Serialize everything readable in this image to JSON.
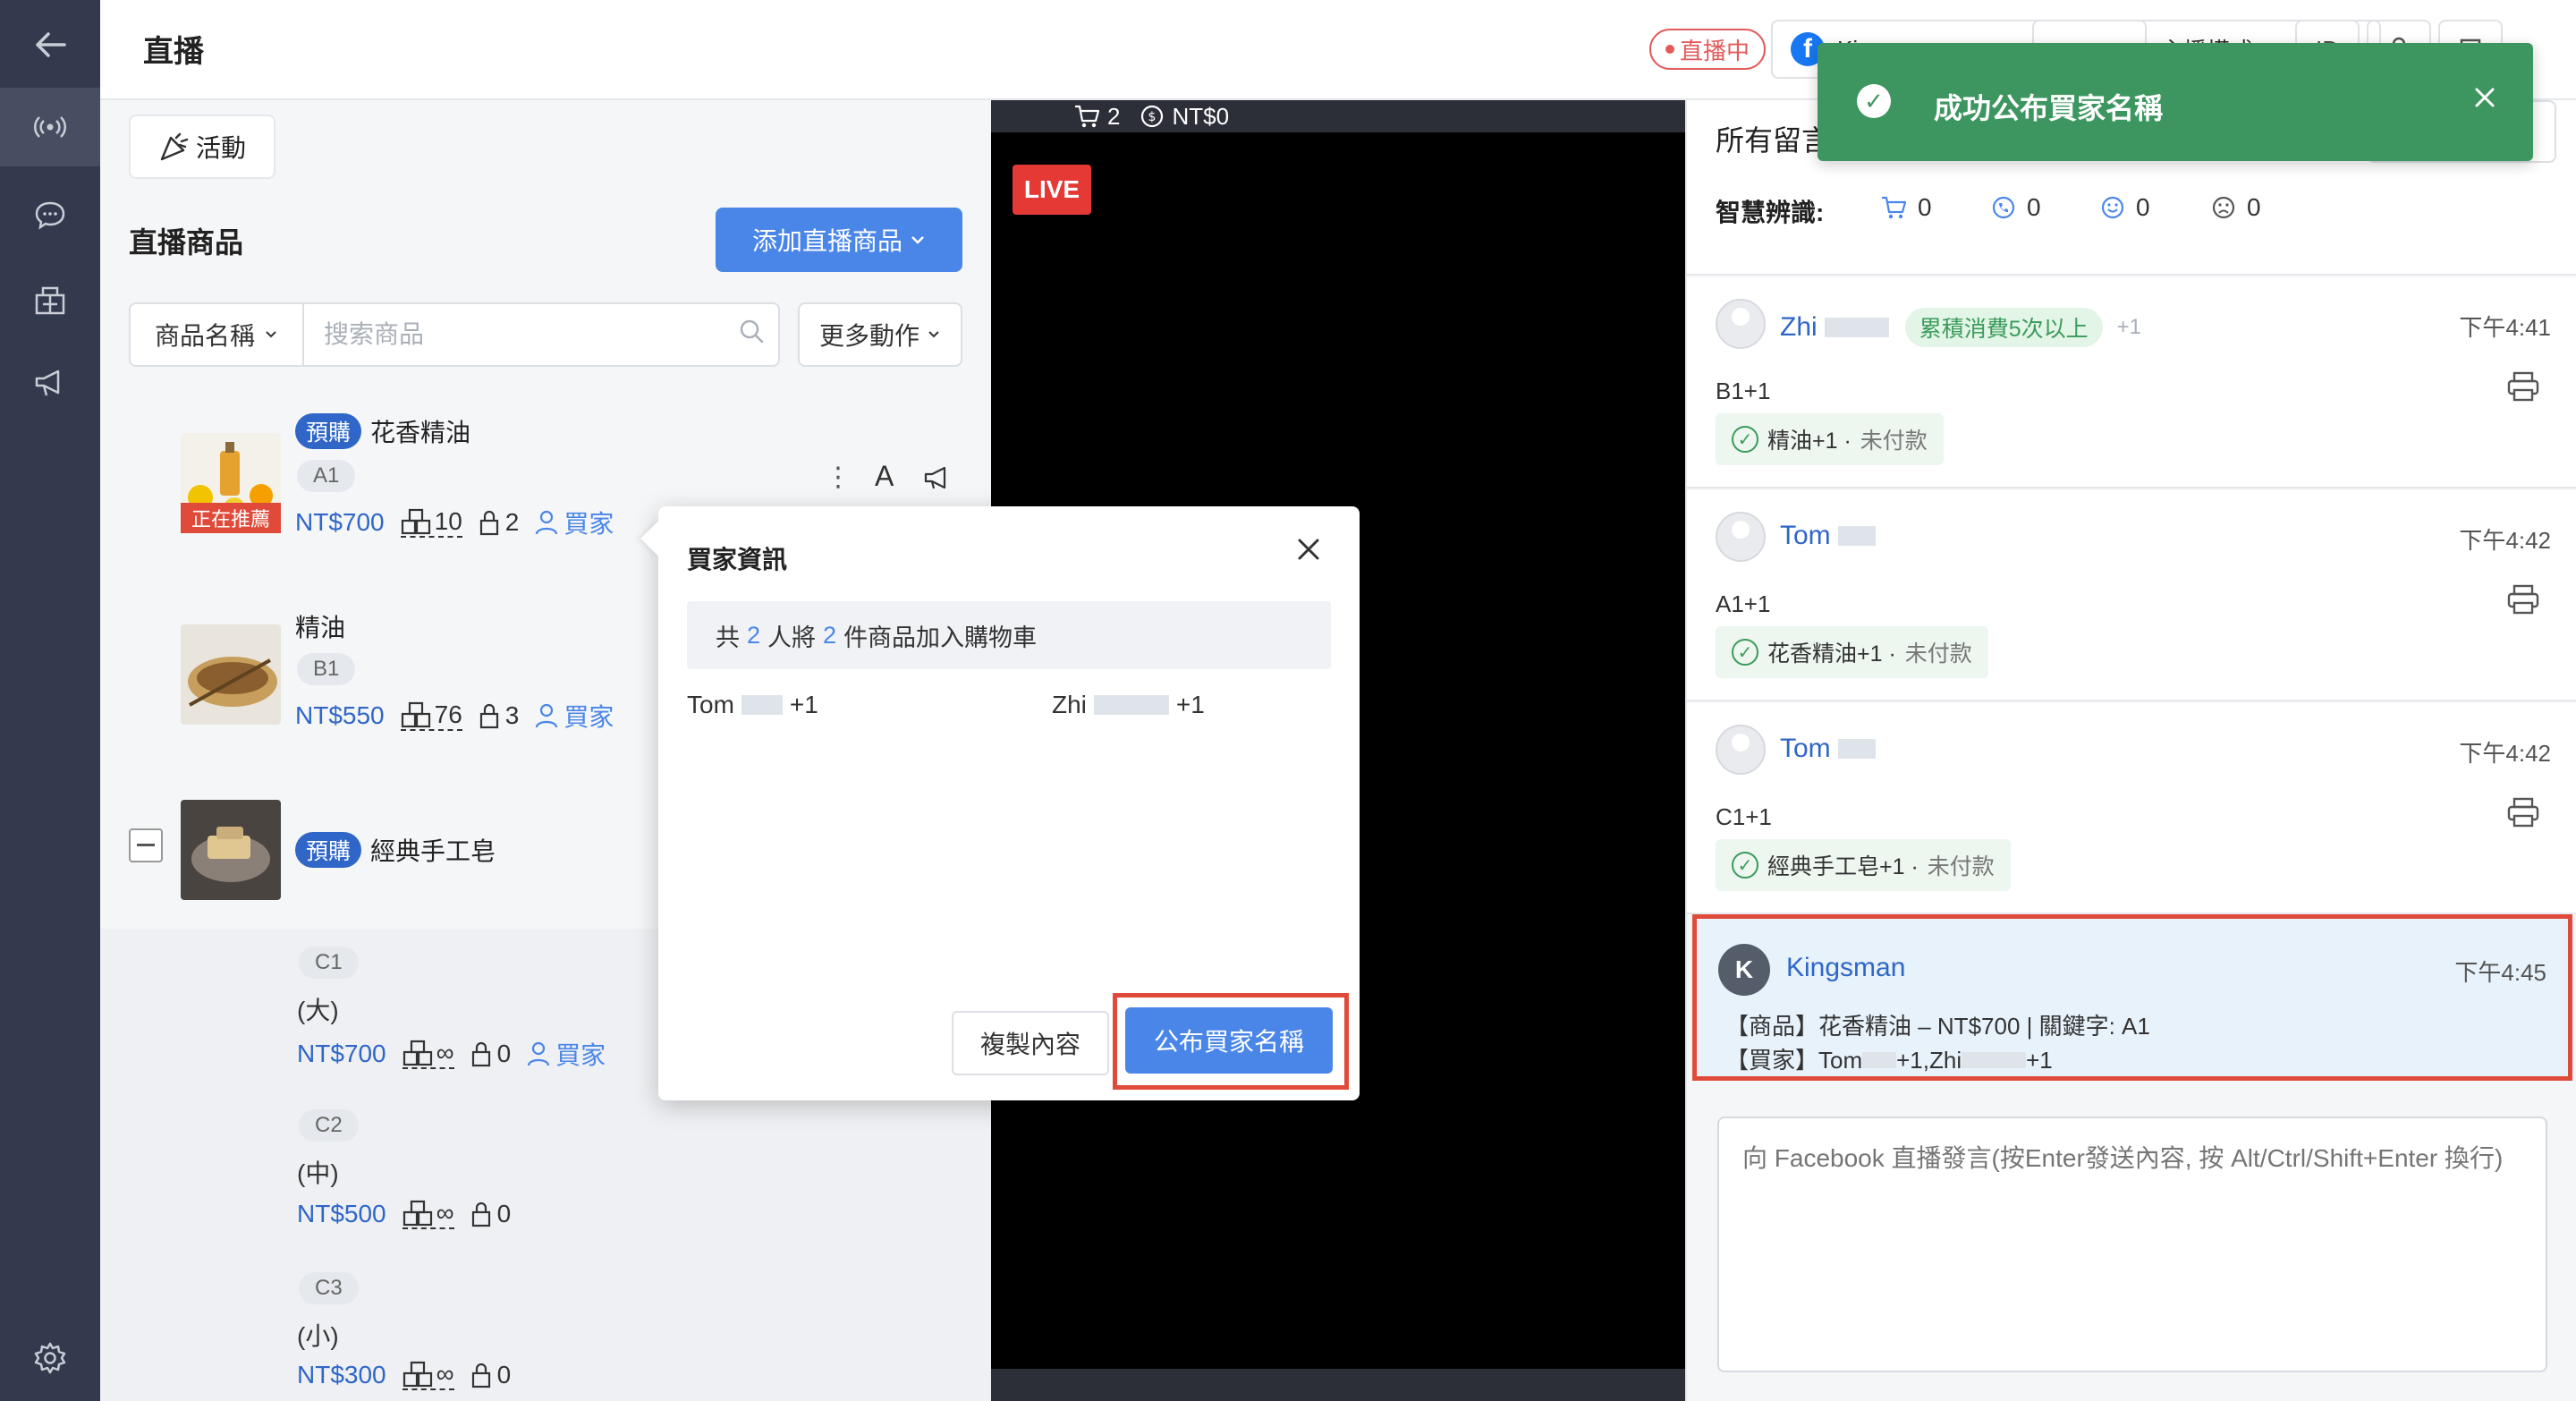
{
  "header": {
    "title": "直播",
    "live_status": "直播中",
    "fb_account": "Kingsman",
    "mode_label": "主播模式",
    "icon_btn_labels": [
      "ID",
      "",
      ""
    ]
  },
  "left": {
    "activity_label": "活動",
    "section_title": "直播商品",
    "add_product_label": "添加直播商品",
    "search_field": "商品名稱",
    "search_placeholder": "搜索商品",
    "more_actions_label": "更多動作",
    "products": [
      {
        "pre_order": "預購",
        "name": "花香精油",
        "code": "A1",
        "price": "NT$700",
        "stock": "10",
        "locked": "2",
        "buyer_label": "買家",
        "pushing": "正在推薦"
      },
      {
        "name": "精油",
        "code": "B1",
        "price": "NT$550",
        "stock": "76",
        "locked": "3",
        "buyer_label": "買家"
      },
      {
        "pre_order": "預購",
        "name": "經典手工皂"
      }
    ],
    "variants": [
      {
        "code": "C1",
        "size": "(大)",
        "price": "NT$700",
        "stock": "∞",
        "locked": "0",
        "buyer_label": "買家"
      },
      {
        "code": "C2",
        "size": "(中)",
        "price": "NT$500",
        "stock": "∞",
        "locked": "0"
      },
      {
        "code": "C3",
        "size": "(小)",
        "price": "NT$300",
        "stock": "∞",
        "locked": "0"
      }
    ]
  },
  "video": {
    "cart_count": "2",
    "amount": "NT$0",
    "live_label": "LIVE"
  },
  "right": {
    "title": "所有留言",
    "smart_label": "智慧辨識:",
    "smart_counts": [
      "0",
      "0",
      "0",
      "0"
    ],
    "comments": [
      {
        "name": "Zhi",
        "badge": "累積消費5次以上",
        "extra": "+1",
        "time": "下午4:41",
        "text": "B1+1",
        "status_item": "精油+1 ·",
        "status_pay": "未付款"
      },
      {
        "name": "Tom",
        "time": "下午4:42",
        "text": "A1+1",
        "status_item": "花香精油+1 ·",
        "status_pay": "未付款"
      },
      {
        "name": "Tom",
        "time": "下午4:42",
        "text": "C1+1",
        "status_item": "經典手工皂+1 ·",
        "status_pay": "未付款"
      }
    ],
    "kingsman": {
      "initial": "K",
      "name": "Kingsman",
      "time": "下午4:45",
      "line1": "【商品】花香精油 – NT$700 | 關鍵字: A1",
      "line2_prefix": "【買家】Tom",
      "line2_mid": "+1,Zhi",
      "line2_suffix": "+1"
    },
    "message_placeholder": "向 Facebook 直播發言(按Enter發送內容, 按 Alt/Ctrl/Shift+Enter 換行)"
  },
  "modal": {
    "title": "買家資訊",
    "summary_prefix": "共",
    "people": "2",
    "summary_mid": "人將",
    "items": "2",
    "summary_suffix": "件商品加入購物車",
    "buyers": [
      {
        "name": "Tom",
        "qty": "+1"
      },
      {
        "name": "Zhi",
        "qty": "+1"
      }
    ],
    "copy_label": "複製內容",
    "publish_label": "公布買家名稱"
  },
  "toast": {
    "message": "成功公布買家名稱"
  },
  "colors": {
    "accent": "#4a86e8",
    "sidebar": "#343a4d",
    "success": "#3d9660",
    "highlight": "#e04a3a",
    "live": "#e53935"
  }
}
